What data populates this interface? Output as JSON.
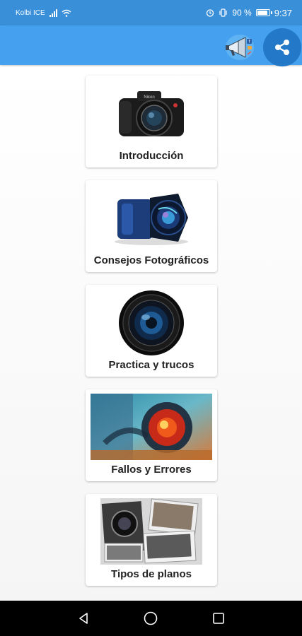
{
  "status_bar": {
    "carrier": "Kolbi ICE",
    "battery": "90 %",
    "time": "9:37",
    "icons": [
      "signal-icon",
      "wifi-icon",
      "alarm-icon",
      "vibrate-icon",
      "battery-icon"
    ]
  },
  "app_bar": {
    "color": "#45a1f0",
    "actions": [
      {
        "name": "promo-megaphone-icon"
      },
      {
        "name": "share-icon"
      }
    ]
  },
  "menu": {
    "items": [
      {
        "label": "Introducción",
        "icon": "dslr-camera-icon"
      },
      {
        "label": "Consejos Fotográficos",
        "icon": "camera-lens-blue-icon"
      },
      {
        "label": "Practica y trucos",
        "icon": "lens-front-icon"
      },
      {
        "label": "Fallos y Errores",
        "icon": "lens-closeup-image"
      },
      {
        "label": "Tipos de planos",
        "icon": "photo-collage-image"
      }
    ]
  },
  "nav_bar": {
    "buttons": [
      "back-icon",
      "home-icon",
      "recents-icon"
    ]
  }
}
